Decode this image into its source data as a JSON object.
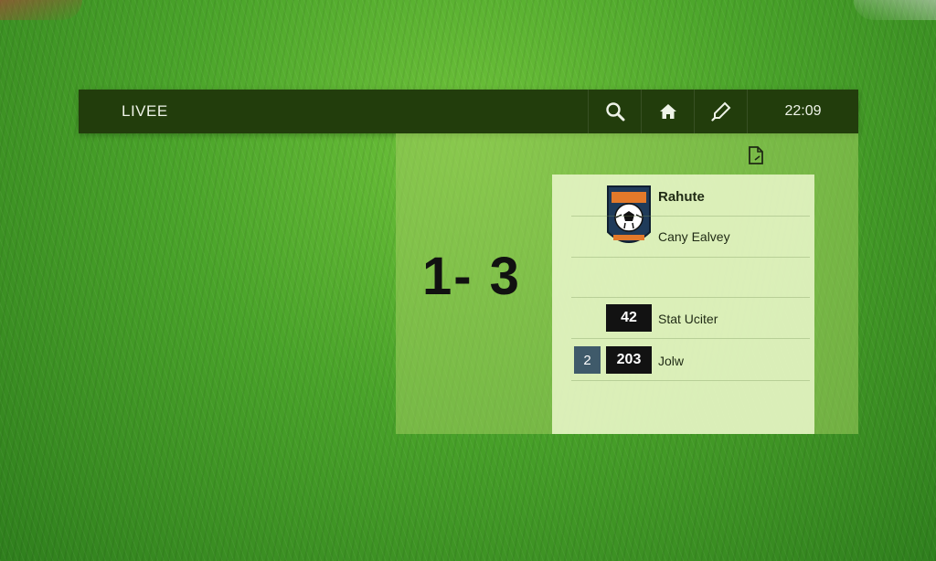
{
  "header": {
    "title": "LIVEE",
    "clock": "22:09",
    "icons": [
      "search-icon",
      "home-icon",
      "pencil-icon"
    ]
  },
  "score": {
    "display": "1- 3"
  },
  "panel": {
    "doc_icon": "document-icon",
    "team": {
      "name": "Rahute",
      "subtitle": "Cany Ealvey",
      "crest_icon": "soccer-crest-icon"
    },
    "stats": [
      {
        "value": "42",
        "label": "Stat Uciter"
      },
      {
        "value": "203",
        "label": "Jolw"
      }
    ],
    "side_chip": "2"
  },
  "colors": {
    "header_bg": "#223d0c",
    "overlay": "#a0cd5f",
    "card": "#e8f6c8",
    "badge": "#121212",
    "chip": "#3f5a6a"
  }
}
